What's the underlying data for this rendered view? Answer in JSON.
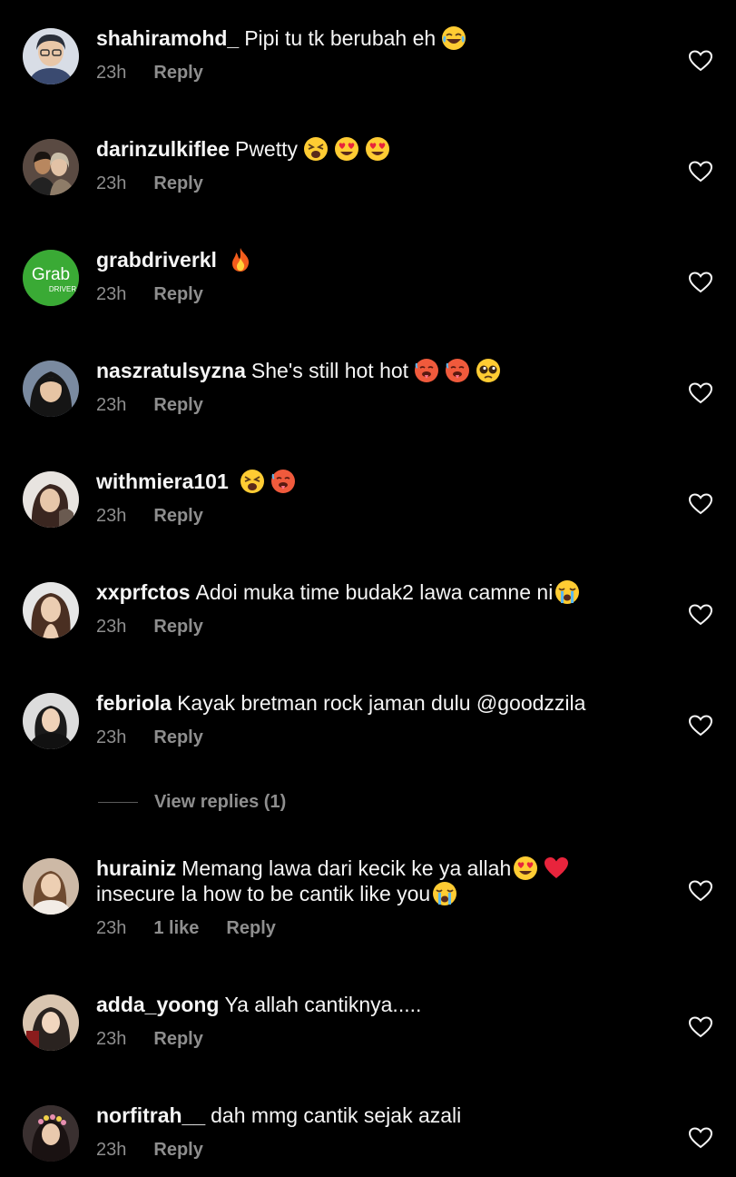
{
  "comments": [
    {
      "username": "shahiramohd_",
      "text": "Pipi tu tk berubah eh",
      "emojis": [
        "joy"
      ],
      "time": "23h",
      "likes": "",
      "reply": "Reply",
      "avatar": "boy-glasses"
    },
    {
      "username": "darinzulkiflee",
      "text": "Pwetty",
      "emojis": [
        "weary",
        "heart-eyes",
        "heart-eyes"
      ],
      "time": "23h",
      "likes": "",
      "reply": "Reply",
      "avatar": "couple"
    },
    {
      "username": "grabdriverkl",
      "text": "",
      "emojis": [
        "fire"
      ],
      "time": "23h",
      "likes": "",
      "reply": "Reply",
      "avatar": "grab-logo"
    },
    {
      "username": "naszratulsyzna",
      "text": "She's still hot hot",
      "emojis": [
        "hot-face",
        "hot-face",
        "pleading"
      ],
      "time": "23h",
      "likes": "",
      "reply": "Reply",
      "avatar": "hijab-girl"
    },
    {
      "username": "withmiera101",
      "text": "",
      "emojis": [
        "weary",
        "hot-face"
      ],
      "time": "23h",
      "likes": "",
      "reply": "Reply",
      "avatar": "woman-dark-hair"
    },
    {
      "username": "xxprfctos",
      "text": "Adoi muka time budak2 lawa camne ni",
      "emojis": [
        "sob"
      ],
      "time": "23h",
      "likes": "",
      "reply": "Reply",
      "avatar": "woman-long-hair"
    },
    {
      "username": "febriola",
      "text": "Kayak bretman rock jaman dulu @goodzzila",
      "emojis": [],
      "time": "23h",
      "likes": "",
      "reply": "Reply",
      "avatar": "woman-black-top"
    },
    {
      "username": "hurainiz",
      "text": "Memang lawa dari kecik ke ya allah",
      "text2": "insecure la how to be cantik like you",
      "emojis": [
        "heart-eyes",
        "red-heart"
      ],
      "emojis2": [
        "sob"
      ],
      "time": "23h",
      "likes": "1 like",
      "reply": "Reply",
      "avatar": "woman-selfie"
    },
    {
      "username": "adda_yoong",
      "text": "Ya allah cantiknya.....",
      "emojis": [],
      "time": "23h",
      "likes": "",
      "reply": "Reply",
      "avatar": "woman-hijab-light"
    },
    {
      "username": "norfitrah__",
      "text": "dah mmg cantik sejak azali",
      "emojis": [],
      "time": "23h",
      "likes": "",
      "reply": "Reply",
      "avatar": "woman-flower-crown"
    }
  ],
  "view_replies": "View replies (1)",
  "colors": {
    "background": "#000000",
    "text": "#f5f5f5",
    "secondary": "#8e8e8e",
    "grab_green": "#3aaa35"
  },
  "icons": {
    "like": "heart-outline-icon"
  }
}
